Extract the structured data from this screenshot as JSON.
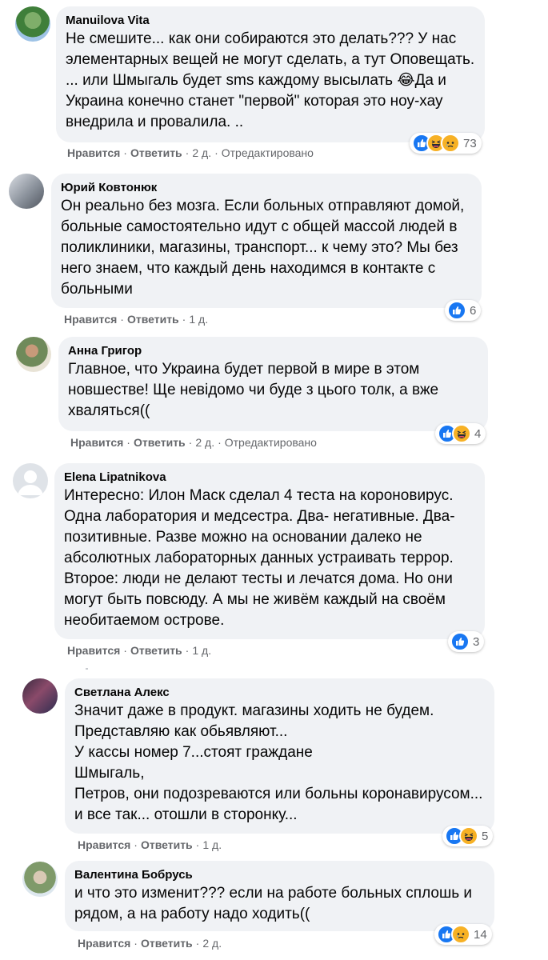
{
  "labels": {
    "like": "Нравится",
    "reply": "Ответить",
    "dot": "·"
  },
  "comments": [
    {
      "author": "Manuilova Vita",
      "text": "Не смешите... как они собираются это делать??? У нас элементарных вещей не могут сделать, а тут Оповещать. ... или Шмыгаль будет sms каждому высылать 😂Да и Украина конечно станет \"первой\" которая это ноу-хау внедрила и провалила. ..",
      "time": "2 д.",
      "edited": "Отредактировано",
      "reactions": [
        "like-icon",
        "haha-icon",
        "sad-icon"
      ],
      "reaction_count": "73"
    },
    {
      "author": "Юрий Ковтонюк",
      "text": "Он реально без мозга. Если больных отправляют домой, больные самостоятельно идут с общей массой людей в поликлиники, магазины, транспорт... к чему это? Мы без него знаем, что каждый день находимся в контакте с больными",
      "time": "1 д.",
      "reactions": [
        "like-icon"
      ],
      "reaction_count": "6"
    },
    {
      "author": "Анна Григор",
      "text": "Главное, что Украина будет первой в мире в этом новшестве! Ще невідомо чи буде з цього толк, а вже хваляться((",
      "time": "2 д.",
      "edited": "Отредактировано",
      "reactions": [
        "like-icon",
        "haha-icon"
      ],
      "reaction_count": "4"
    },
    {
      "author": "Elena Lipatnikova",
      "text": "Интересно: Илон Маск сделал 4 теста на короновирус. Одна лаборатория и медсестра. Два- негативные. Два- позитивные. Разве можно на основании далеко не абсолютных лабораторных данных устраивать террор. Второе: люди не делают тесты и лечатся дома. Но они могут быть повсюду. А мы не живём каждый на своём необитаемом острове.",
      "time": "1 д.",
      "reactions": [
        "like-icon"
      ],
      "reaction_count": "3"
    },
    {
      "author": "Светлана Алекс",
      "text": "Значит даже в продукт. магазины ходить не будем.\nПредставляю как обьявляют...\nУ кассы номер 7...стоят граждане\nШмыгаль,\nПетров, они подозреваются или больны коронавирусом... и все так... отошли в сторонку...",
      "time": "1 д.",
      "reactions": [
        "like-icon",
        "haha-icon"
      ],
      "reaction_count": "5"
    },
    {
      "author": "Валентина Бобрусь",
      "text": "и что это изменит??? если на работе больных сплошь и рядом, а на работу надо ходить((",
      "time": "2 д.",
      "reactions": [
        "like-icon",
        "sad-icon"
      ],
      "reaction_count": "14"
    }
  ]
}
